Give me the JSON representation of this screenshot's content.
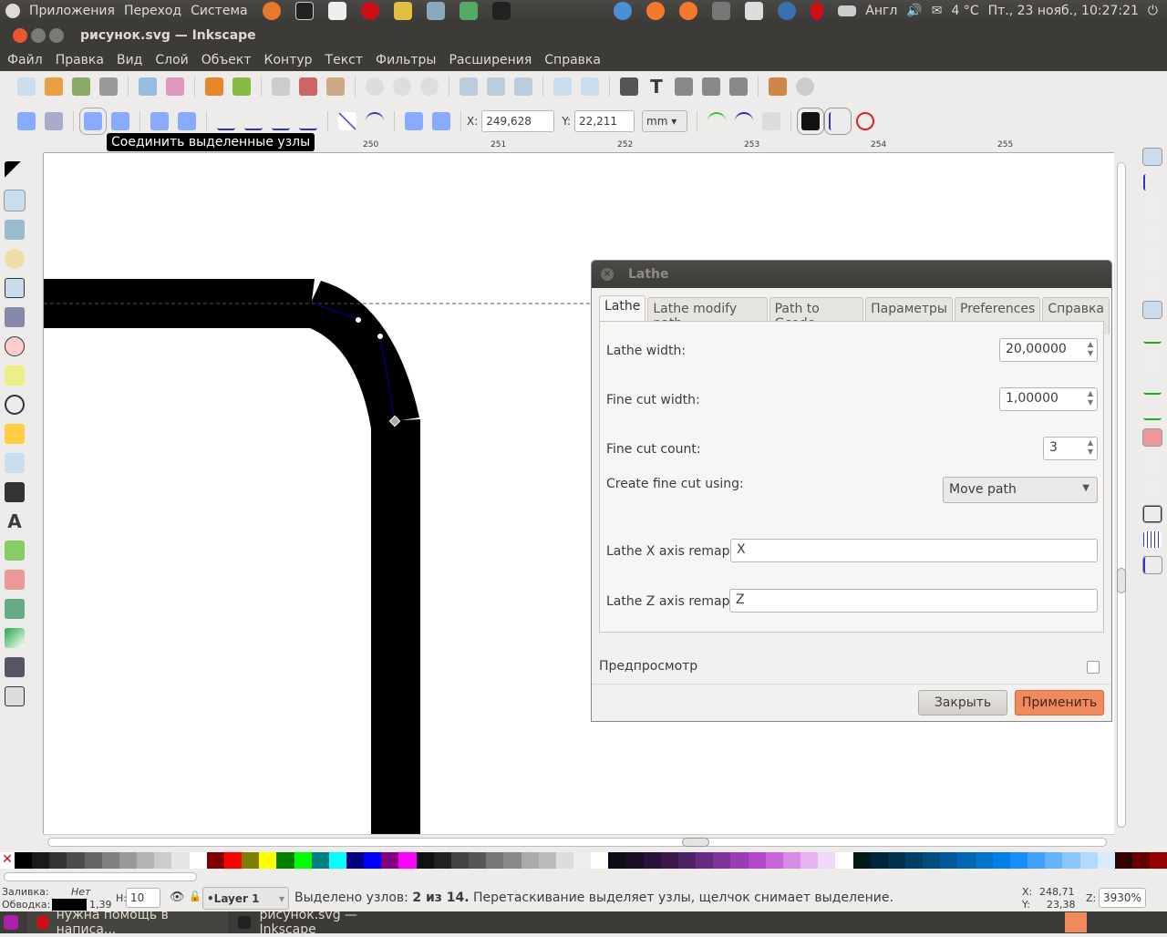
{
  "top_panel": {
    "menus": [
      "Приложения",
      "Переход",
      "Система"
    ],
    "keyboard": "Англ",
    "weather": "4 °C",
    "clock": "Пт., 23 нояб., 10:27:21"
  },
  "window": {
    "title": "рисунок.svg — Inkscape"
  },
  "menubar": [
    "Файл",
    "Правка",
    "Вид",
    "Слой",
    "Объект",
    "Контур",
    "Текст",
    "Фильтры",
    "Расширения",
    "Справка"
  ],
  "node_toolbar": {
    "x_label": "X:",
    "x_value": "249,628",
    "y_label": "Y:",
    "y_value": "22,211",
    "unit": "mm"
  },
  "tooltip": "Соединить выделенные узлы",
  "ruler": {
    "top_ticks": [
      "250",
      "251",
      "252",
      "253",
      "254",
      "255"
    ]
  },
  "dialog": {
    "title": "Lathe",
    "tabs": [
      "Lathe",
      "Lathe modify path",
      "Path to Gcode",
      "Параметры",
      "Preferences",
      "Справка"
    ],
    "active_tab": "Lathe",
    "fields": {
      "lathe_width_label": "Lathe width:",
      "lathe_width": "20,00000",
      "fine_cut_width_label": "Fine cut width:",
      "fine_cut_width": "1,00000",
      "fine_cut_count_label": "Fine cut count:",
      "fine_cut_count": "3",
      "create_fine_cut_label": "Create fine cut using:",
      "create_fine_cut": "Move path",
      "x_remap_label": "Lathe X axis remap:",
      "x_remap": "X",
      "z_remap_label": "Lathe Z axis remap:",
      "z_remap": "Z"
    },
    "preview_label": "Предпросмотр",
    "preview_checked": false,
    "close_button": "Закрыть",
    "apply_button": "Применить",
    "apply_color": "#f08a5d"
  },
  "palette": [
    "#000000",
    "#1a1a1a",
    "#333333",
    "#4d4d4d",
    "#666666",
    "#808080",
    "#999999",
    "#b3b3b3",
    "#cccccc",
    "#e6e6e6",
    "#ffffff",
    "#800000",
    "#ff0000",
    "#808000",
    "#ffff00",
    "#008000",
    "#00ff00",
    "#008080",
    "#00ffff",
    "#000080",
    "#0000ff",
    "#800080",
    "#ff00ff",
    "#111111",
    "#222222",
    "#444444",
    "#555555",
    "#777777",
    "#888888",
    "#aaaaaa",
    "#bbbbbb",
    "#dddddd",
    "#eeeeee",
    "#ffffff",
    "#0d0d1a",
    "#1a0d26",
    "#26133a",
    "#3a1a4d",
    "#4d2266",
    "#662a80",
    "#803399",
    "#993db3",
    "#b347cc",
    "#c766d9",
    "#d98ce6",
    "#e6b3f0",
    "#f0d9f7",
    "#ffffff",
    "#001a1a",
    "#00263a",
    "#00334d",
    "#004066",
    "#004d80",
    "#005a99",
    "#0066b3",
    "#0073cc",
    "#0080e6",
    "#1a8cff",
    "#40a0ff",
    "#66b3ff",
    "#8cc6ff",
    "#b3d9ff",
    "#d9ecff",
    "#330000",
    "#660000",
    "#990000"
  ],
  "status": {
    "fill_label": "Заливка:",
    "fill_value": "Нет",
    "stroke_label": "Обводка:",
    "stroke_width": "1,39",
    "h_label": "H:",
    "h_value": "10",
    "layer": "•Layer 1",
    "message_prefix": "Выделено узлов: ",
    "message_bold": "2 из 14.",
    "message_rest": " Перетаскивание выделяет узлы, щелчок снимает выделение.",
    "x_label": "X:",
    "x": "248,71",
    "y_label": "Y:",
    "y": "23,38",
    "z_label": "Z:",
    "zoom": "3930%"
  },
  "taskbar": [
    "нужна помощь в написа...",
    "рисунок.svg — Inkscape"
  ]
}
